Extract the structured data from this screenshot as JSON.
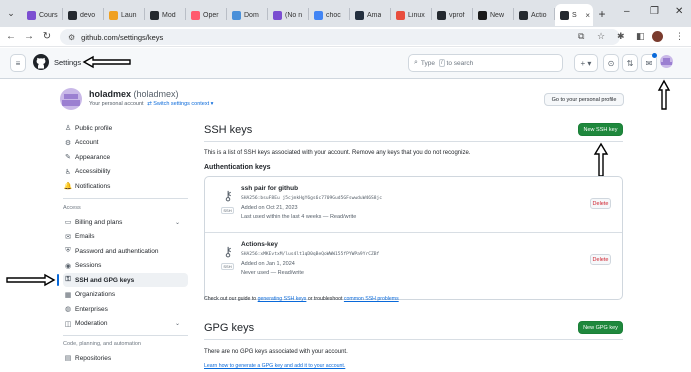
{
  "browser": {
    "tabs": [
      {
        "label": "Cours",
        "color": "#7b4ed1"
      },
      {
        "label": "devo",
        "color": "#24292f"
      },
      {
        "label": "Laun",
        "color": "#f0a020"
      },
      {
        "label": "Mod",
        "color": "#24292f"
      },
      {
        "label": "Oper",
        "color": "#ff5a6e"
      },
      {
        "label": "Dom",
        "color": "#4a90d9"
      },
      {
        "label": "(No n",
        "color": "#7b4ed1"
      },
      {
        "label": "choc",
        "color": "#4285f4"
      },
      {
        "label": "Ama",
        "color": "#232f3e"
      },
      {
        "label": "Linux",
        "color": "#e84d3d"
      },
      {
        "label": "vprof",
        "color": "#24292f"
      },
      {
        "label": "New",
        "color": "#1a1a1a"
      },
      {
        "label": "Actio",
        "color": "#24292f"
      },
      {
        "label": "S",
        "color": "#24292f"
      }
    ],
    "tab_close": "×",
    "new_tab": "+",
    "url": "github.com/settings/keys",
    "window_controls": {
      "minimize": "–",
      "maximize": "❐",
      "close": "✕"
    }
  },
  "header": {
    "menu_glyph": "≡",
    "title": "Settings",
    "search_prefix": "Type",
    "search_key": "/",
    "search_suffix": "to search",
    "plus": "+ ▾",
    "circle": "⊙",
    "pr": "⇅",
    "inbox": "✉"
  },
  "profile": {
    "username": "holadmex",
    "name_display": "(holadmex)",
    "subtitle": "Your personal account",
    "switch_label": "Switch settings context ▾",
    "go_profile_button": "Go to your personal profile"
  },
  "sidebar": {
    "top_items": [
      {
        "label": "Public profile",
        "icon": "person-icon",
        "glyph": "♙"
      },
      {
        "label": "Account",
        "icon": "gear-icon",
        "glyph": "⚙"
      },
      {
        "label": "Appearance",
        "icon": "paintbrush-icon",
        "glyph": "✎"
      },
      {
        "label": "Accessibility",
        "icon": "accessibility-icon",
        "glyph": "♿"
      },
      {
        "label": "Notifications",
        "icon": "bell-icon",
        "glyph": "🔔"
      }
    ],
    "access_heading": "Access",
    "access_items": [
      {
        "label": "Billing and plans",
        "icon": "credit-card-icon",
        "glyph": "▭",
        "caret": "⌄"
      },
      {
        "label": "Emails",
        "icon": "mail-icon",
        "glyph": "✉"
      },
      {
        "label": "Password and authentication",
        "icon": "shield-lock-icon",
        "glyph": "⛨"
      },
      {
        "label": "Sessions",
        "icon": "broadcast-icon",
        "glyph": "◉"
      },
      {
        "label": "SSH and GPG keys",
        "icon": "key-icon",
        "glyph": "⚿",
        "selected": true
      },
      {
        "label": "Organizations",
        "icon": "organization-icon",
        "glyph": "▦"
      },
      {
        "label": "Enterprises",
        "icon": "globe-icon",
        "glyph": "◍"
      },
      {
        "label": "Moderation",
        "icon": "report-icon",
        "glyph": "◫",
        "caret": "⌄"
      }
    ],
    "code_heading": "Code, planning, and automation",
    "code_items": [
      {
        "label": "Repositories",
        "icon": "repo-icon",
        "glyph": "▤"
      }
    ]
  },
  "ssh": {
    "title": "SSH keys",
    "new_button": "New SSH key",
    "description": "This is a list of SSH keys associated with your account. Remove any keys that you do not recognize.",
    "auth_heading": "Authentication keys",
    "type_tag": "SSH",
    "delete_label": "Delete",
    "keys": [
      {
        "name": "ssh pair for github",
        "fingerprint": "SHA256:bsuF8Eu j5cjmkHgY6gs6c7709Gud5GFswwduW46S8jc",
        "added": "Added on Oct 21, 2023",
        "last_used": "Last used within the last 4 weeks — Read/write"
      },
      {
        "name": "Actions-key",
        "fingerprint": "SHA256:xMKEvtxM/lus4lt1qD0qBeQoWWW155fPYWPa9YrCZBf",
        "added": "Added on Jan 1, 2024",
        "last_used": "Never used — Read/write"
      }
    ],
    "guide_prefix": "Check out our guide to",
    "guide_link": "generating SSH keys",
    "guide_middle": "or troubleshoot",
    "guide_link2": "common SSH problems"
  },
  "gpg": {
    "title": "GPG keys",
    "new_button": "New GPG key",
    "empty_text": "There are no GPG keys associated with your account.",
    "learn_text": "Learn how to generate a GPG key and add it to your account."
  },
  "colors": {
    "accent_green": "#1f883d",
    "link_blue": "#0969da",
    "danger_red": "#cf222e",
    "selected_bar": "#0969da"
  }
}
